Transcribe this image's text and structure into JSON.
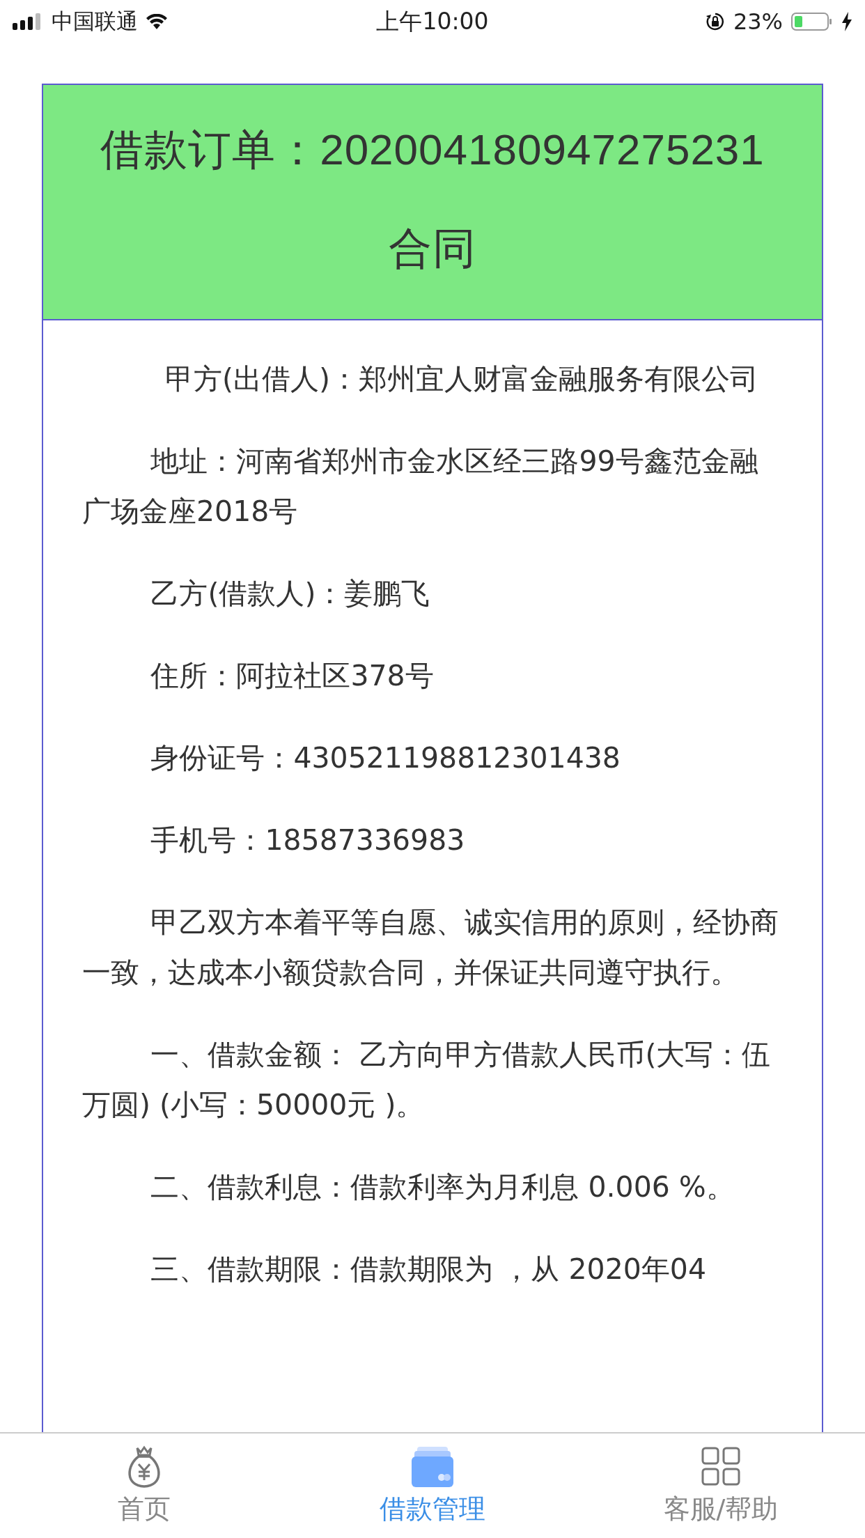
{
  "status_bar": {
    "carrier": "中国联通",
    "time": "上午10:00",
    "battery_percent": "23%"
  },
  "contract": {
    "title_lines": [
      "借款订单：202004180947275231",
      "合同"
    ],
    "paragraphs": [
      "甲方(出借人)：郑州宜人财富金融服务有限公司",
      "地址：河南省郑州市金水区经三路99号鑫范金融广场金座2018号",
      "乙方(借款人)：姜鹏飞",
      "住所：阿拉社区378号",
      "身份证号：430521198812301438",
      "手机号：18587336983",
      "甲乙双方本着平等自愿、诚实信用的原则，经协商一致，达成本小额贷款合同，并保证共同遵守执行。",
      "一、借款金额： 乙方向甲方借款人民币(大写：伍万圆) (小写：50000元 )。",
      "二、借款利息：借款利率为月利息 0.006 %。",
      "三、借款期限：借款期限为 ，从 2020年04"
    ]
  },
  "tab_bar": [
    {
      "label": "首页",
      "kind": "bag",
      "selected": false
    },
    {
      "label": "借款管理",
      "kind": "card",
      "selected": true
    },
    {
      "label": "客服/帮助",
      "kind": "service",
      "selected": false
    }
  ]
}
